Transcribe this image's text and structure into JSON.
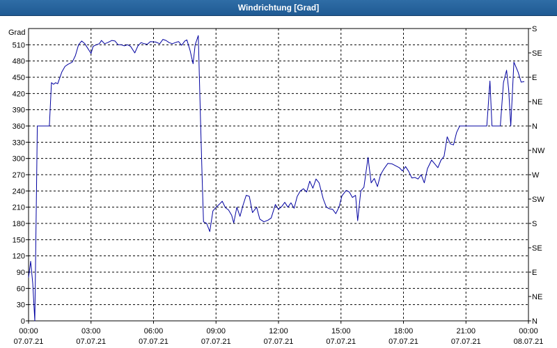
{
  "window": {
    "title": "Windrichtung [Grad]"
  },
  "chart_data": {
    "type": "line",
    "title": "Windrichtung [Grad]",
    "ylabel": "Grad",
    "xlabel": "",
    "xlim_hours": [
      0,
      24
    ],
    "ylim": [
      0,
      540
    ],
    "grid": true,
    "colors": {
      "line": "#0000a0",
      "grid": "#000000",
      "axis": "#000000"
    },
    "y_ticks": [
      0,
      30,
      60,
      90,
      120,
      150,
      180,
      210,
      240,
      270,
      300,
      330,
      360,
      390,
      420,
      450,
      480,
      510
    ],
    "right_ticks": [
      {
        "value": 0,
        "label": "N"
      },
      {
        "value": 45,
        "label": "NE"
      },
      {
        "value": 90,
        "label": "E"
      },
      {
        "value": 135,
        "label": "SE"
      },
      {
        "value": 180,
        "label": "S"
      },
      {
        "value": 225,
        "label": "SW"
      },
      {
        "value": 270,
        "label": "W"
      },
      {
        "value": 315,
        "label": "NW"
      },
      {
        "value": 360,
        "label": "N"
      },
      {
        "value": 405,
        "label": "NE"
      },
      {
        "value": 450,
        "label": "E"
      },
      {
        "value": 495,
        "label": "SE"
      },
      {
        "value": 540,
        "label": "S"
      }
    ],
    "x_ticks": [
      {
        "hour": 0,
        "time": "00:00",
        "date": "07.07.21"
      },
      {
        "hour": 3,
        "time": "03:00",
        "date": "07.07.21"
      },
      {
        "hour": 6,
        "time": "06:00",
        "date": "07.07.21"
      },
      {
        "hour": 9,
        "time": "09:00",
        "date": "07.07.21"
      },
      {
        "hour": 12,
        "time": "12:00",
        "date": "07.07.21"
      },
      {
        "hour": 15,
        "time": "15:00",
        "date": "07.07.21"
      },
      {
        "hour": 18,
        "time": "18:00",
        "date": "07.07.21"
      },
      {
        "hour": 21,
        "time": "21:00",
        "date": "07.07.21"
      },
      {
        "hour": 24,
        "time": "00:00",
        "date": "08.07.21"
      }
    ],
    "series": [
      {
        "points": [
          [
            0.0,
            80
          ],
          [
            0.1,
            110
          ],
          [
            0.2,
            70
          ],
          [
            0.3,
            0
          ],
          [
            0.42,
            360
          ],
          [
            0.83,
            360
          ],
          [
            1.0,
            360
          ],
          [
            1.1,
            440
          ],
          [
            1.2,
            437
          ],
          [
            1.3,
            440
          ],
          [
            1.4,
            438
          ],
          [
            1.6,
            460
          ],
          [
            1.75,
            470
          ],
          [
            1.9,
            474
          ],
          [
            2.0,
            476
          ],
          [
            2.1,
            478
          ],
          [
            2.25,
            490
          ],
          [
            2.4,
            510
          ],
          [
            2.55,
            517
          ],
          [
            2.7,
            512
          ],
          [
            2.85,
            503
          ],
          [
            3.0,
            494
          ],
          [
            3.1,
            507
          ],
          [
            3.25,
            510
          ],
          [
            3.4,
            512
          ],
          [
            3.5,
            518
          ],
          [
            3.65,
            512
          ],
          [
            3.8,
            514
          ],
          [
            4.0,
            518
          ],
          [
            4.15,
            517
          ],
          [
            4.3,
            510
          ],
          [
            4.45,
            510
          ],
          [
            4.6,
            508
          ],
          [
            4.75,
            510
          ],
          [
            4.9,
            507
          ],
          [
            5.1,
            495
          ],
          [
            5.25,
            508
          ],
          [
            5.4,
            514
          ],
          [
            5.55,
            512
          ],
          [
            5.7,
            511
          ],
          [
            5.85,
            516
          ],
          [
            6.1,
            515
          ],
          [
            6.3,
            512
          ],
          [
            6.45,
            520
          ],
          [
            6.6,
            518
          ],
          [
            6.75,
            514
          ],
          [
            6.9,
            512
          ],
          [
            7.05,
            514
          ],
          [
            7.2,
            516
          ],
          [
            7.35,
            509
          ],
          [
            7.5,
            517
          ],
          [
            7.6,
            519
          ],
          [
            7.75,
            500
          ],
          [
            7.9,
            475
          ],
          [
            8.0,
            510
          ],
          [
            8.15,
            527
          ],
          [
            8.25,
            380
          ],
          [
            8.33,
            270
          ],
          [
            8.4,
            183
          ],
          [
            8.55,
            180
          ],
          [
            8.7,
            165
          ],
          [
            8.85,
            203
          ],
          [
            9.0,
            210
          ],
          [
            9.15,
            215
          ],
          [
            9.3,
            221
          ],
          [
            9.45,
            209
          ],
          [
            9.6,
            205
          ],
          [
            9.75,
            195
          ],
          [
            9.85,
            181
          ],
          [
            10.0,
            210
          ],
          [
            10.15,
            193
          ],
          [
            10.3,
            214
          ],
          [
            10.45,
            232
          ],
          [
            10.6,
            230
          ],
          [
            10.75,
            200
          ],
          [
            10.95,
            210
          ],
          [
            11.1,
            188
          ],
          [
            11.3,
            183
          ],
          [
            11.5,
            186
          ],
          [
            11.65,
            190
          ],
          [
            11.85,
            215
          ],
          [
            12.0,
            206
          ],
          [
            12.15,
            211
          ],
          [
            12.3,
            219
          ],
          [
            12.45,
            210
          ],
          [
            12.6,
            218
          ],
          [
            12.75,
            208
          ],
          [
            12.9,
            230
          ],
          [
            13.05,
            240
          ],
          [
            13.2,
            244
          ],
          [
            13.35,
            238
          ],
          [
            13.5,
            258
          ],
          [
            13.65,
            245
          ],
          [
            13.8,
            262
          ],
          [
            13.95,
            255
          ],
          [
            14.15,
            225
          ],
          [
            14.3,
            210
          ],
          [
            14.45,
            207
          ],
          [
            14.6,
            206
          ],
          [
            14.75,
            198
          ],
          [
            14.9,
            210
          ],
          [
            15.05,
            231
          ],
          [
            15.25,
            241
          ],
          [
            15.4,
            238
          ],
          [
            15.55,
            228
          ],
          [
            15.7,
            232
          ],
          [
            15.8,
            185
          ],
          [
            15.95,
            240
          ],
          [
            16.1,
            247
          ],
          [
            16.3,
            302
          ],
          [
            16.45,
            255
          ],
          [
            16.6,
            263
          ],
          [
            16.75,
            248
          ],
          [
            16.9,
            270
          ],
          [
            17.05,
            280
          ],
          [
            17.25,
            291
          ],
          [
            17.45,
            290
          ],
          [
            17.65,
            286
          ],
          [
            17.8,
            283
          ],
          [
            17.95,
            277
          ],
          [
            18.1,
            285
          ],
          [
            18.25,
            276
          ],
          [
            18.4,
            264
          ],
          [
            18.55,
            265
          ],
          [
            18.7,
            262
          ],
          [
            18.85,
            270
          ],
          [
            19.0,
            255
          ],
          [
            19.15,
            281
          ],
          [
            19.35,
            297
          ],
          [
            19.5,
            290
          ],
          [
            19.65,
            283
          ],
          [
            19.8,
            297
          ],
          [
            19.95,
            304
          ],
          [
            20.1,
            340
          ],
          [
            20.25,
            327
          ],
          [
            20.4,
            325
          ],
          [
            20.55,
            348
          ],
          [
            20.7,
            360
          ],
          [
            21.0,
            360
          ],
          [
            21.5,
            360
          ],
          [
            21.9,
            360
          ],
          [
            22.0,
            360
          ],
          [
            22.15,
            443
          ],
          [
            22.25,
            360
          ],
          [
            22.5,
            360
          ],
          [
            22.65,
            360
          ],
          [
            22.8,
            440
          ],
          [
            22.95,
            463
          ],
          [
            23.05,
            427
          ],
          [
            23.15,
            360
          ],
          [
            23.3,
            478
          ],
          [
            23.5,
            460
          ],
          [
            23.65,
            441
          ],
          [
            23.8,
            442
          ]
        ]
      }
    ]
  }
}
